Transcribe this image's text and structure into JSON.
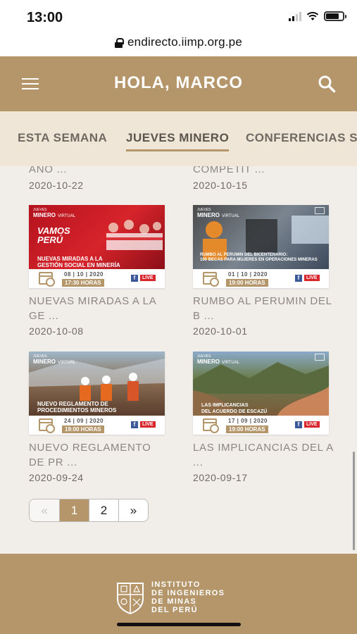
{
  "status_bar": {
    "time": "13:00"
  },
  "browser": {
    "url": "endirecto.iimp.org.pe"
  },
  "header": {
    "title": "HOLA, MARCO"
  },
  "tabs": [
    {
      "label": "ESTA SEMANA"
    },
    {
      "label": "JUEVES MINERO",
      "active": true
    },
    {
      "label": "CONFERENCIAS S"
    }
  ],
  "previous_row": [
    {
      "title": "AÑO ...",
      "date": "2020-10-22"
    },
    {
      "title": "COMPETIT ...",
      "date": "2020-10-15"
    }
  ],
  "cards": [
    {
      "title": "NUEVAS MIRADAS A LA GE ...",
      "date": "2020-10-08",
      "thumb": {
        "brand_top": "JUEVES",
        "brand": "MINERO",
        "brand_sub": "VIRTUAL",
        "slogan": "VAMOS PERÚ",
        "caption_1": "NUEVAS MIRADAS A LA",
        "caption_2": "GESTIÓN SOCIAL EN MINERÍA",
        "event_date": "08 | 10 | 2020",
        "event_time": "17:30 HORAS",
        "live": "LIVE"
      }
    },
    {
      "title": "RUMBO AL PERUMIN DEL B ...",
      "date": "2020-10-01",
      "thumb": {
        "brand_top": "JUEVES",
        "brand": "MINERO",
        "brand_sub": "VIRTUAL",
        "caption_1": "RUMBO AL PERUMIN DEL BICENTENARIO:",
        "caption_2": "100 BECAS PARA MUJERES EN OPERACIONES MINERAS",
        "event_date": "01 | 10 | 2020",
        "event_time": "19:00 HORAS",
        "live": "LIVE"
      }
    },
    {
      "title": "NUEVO REGLAMENTO DE PR ...",
      "date": "2020-09-24",
      "thumb": {
        "brand_top": "JUEVES",
        "brand": "MINERO",
        "brand_sub": "VIRTUAL",
        "caption_1": "NUEVO REGLAMENTO DE",
        "caption_2": "PROCEDIMIENTOS MINEROS",
        "event_date": "24 | 09 | 2020",
        "event_time": "19:00 HORAS",
        "live": "LIVE"
      }
    },
    {
      "title": "LAS IMPLICANCIAS DEL A ...",
      "date": "2020-09-17",
      "thumb": {
        "brand_top": "JUEVES",
        "brand": "MINERO",
        "brand_sub": "VIRTUAL",
        "caption_1": "LAS IMPLICANCIAS",
        "caption_2": "DEL ACUERDO DE ESCAZÚ",
        "event_date": "17 | 09 | 2020",
        "event_time": "19:00 HORAS",
        "live": "LIVE"
      }
    }
  ],
  "pagination": {
    "prev": "«",
    "pages": [
      "1",
      "2"
    ],
    "current": "1",
    "next": "»"
  },
  "footer": {
    "org_lines": [
      "INSTITUTO",
      "DE INGENIEROS",
      "DE MINAS",
      "DEL PERÚ"
    ]
  },
  "colors": {
    "gold": "#b5956a",
    "tab_bg": "#efe6d8",
    "page_bg": "#f1eeea",
    "live_red": "#d9262c",
    "facebook_blue": "#3b5998"
  }
}
